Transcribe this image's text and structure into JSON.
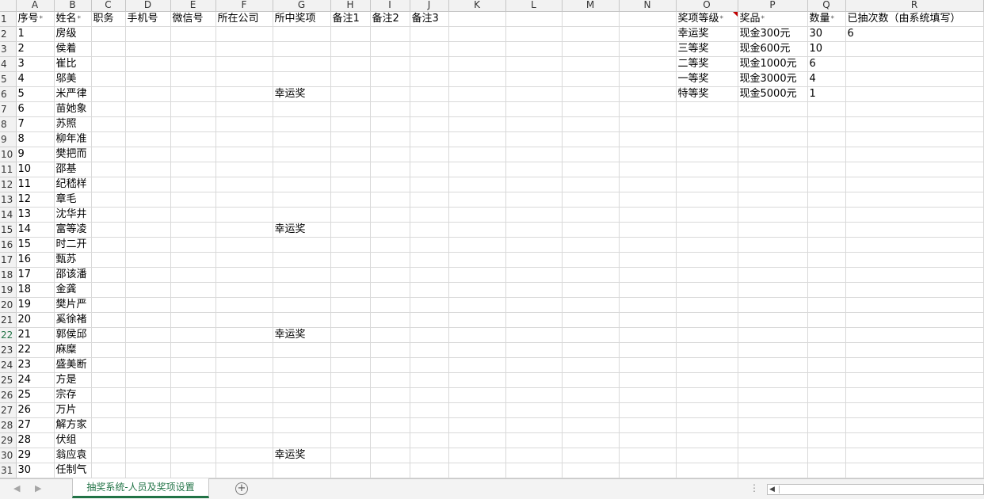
{
  "columns": [
    "A",
    "B",
    "C",
    "D",
    "E",
    "F",
    "G",
    "H",
    "I",
    "J",
    "K",
    "L",
    "M",
    "N",
    "O",
    "P",
    "Q",
    "R"
  ],
  "header_row": {
    "A": "序号",
    "B": "姓名",
    "C": "职务",
    "D": "手机号",
    "E": "微信号",
    "F": "所在公司",
    "G": "所中奖项",
    "H": "备注1",
    "I": "备注2",
    "J": "备注3",
    "O": "奖项等级",
    "P": "奖品",
    "Q": "数量",
    "R": "已抽次数（由系统填写）"
  },
  "required_marker": "*",
  "people": [
    {
      "id": "1",
      "name": "房级",
      "prize": ""
    },
    {
      "id": "2",
      "name": "侯着",
      "prize": ""
    },
    {
      "id": "3",
      "name": "崔比",
      "prize": ""
    },
    {
      "id": "4",
      "name": "邬美",
      "prize": ""
    },
    {
      "id": "5",
      "name": "米严律",
      "prize": "幸运奖"
    },
    {
      "id": "6",
      "name": "苗她象",
      "prize": ""
    },
    {
      "id": "7",
      "name": "苏照",
      "prize": ""
    },
    {
      "id": "8",
      "name": "柳年准",
      "prize": ""
    },
    {
      "id": "9",
      "name": "樊把而",
      "prize": ""
    },
    {
      "id": "10",
      "name": "邵基",
      "prize": ""
    },
    {
      "id": "11",
      "name": "纪嵇样",
      "prize": ""
    },
    {
      "id": "12",
      "name": "章毛",
      "prize": ""
    },
    {
      "id": "13",
      "name": "沈华井",
      "prize": ""
    },
    {
      "id": "14",
      "name": "富等凌",
      "prize": "幸运奖"
    },
    {
      "id": "15",
      "name": "时二开",
      "prize": ""
    },
    {
      "id": "16",
      "name": "甄苏",
      "prize": ""
    },
    {
      "id": "17",
      "name": "邵该潘",
      "prize": ""
    },
    {
      "id": "18",
      "name": "金龚",
      "prize": ""
    },
    {
      "id": "19",
      "name": "樊片严",
      "prize": ""
    },
    {
      "id": "20",
      "name": "奚徐褚",
      "prize": ""
    },
    {
      "id": "21",
      "name": "郭侯邱",
      "prize": "幸运奖"
    },
    {
      "id": "22",
      "name": "麻糜",
      "prize": ""
    },
    {
      "id": "23",
      "name": "盛美断",
      "prize": ""
    },
    {
      "id": "24",
      "name": "方是",
      "prize": ""
    },
    {
      "id": "25",
      "name": "宗存",
      "prize": ""
    },
    {
      "id": "26",
      "name": "万片",
      "prize": ""
    },
    {
      "id": "27",
      "name": "解方家",
      "prize": ""
    },
    {
      "id": "28",
      "name": "伏组",
      "prize": ""
    },
    {
      "id": "29",
      "name": "翁应袁",
      "prize": "幸运奖"
    },
    {
      "id": "30",
      "name": "任制气",
      "prize": ""
    }
  ],
  "awards": [
    {
      "level": "幸运奖",
      "item": "现金300元",
      "qty": "30",
      "drawn": "6"
    },
    {
      "level": "三等奖",
      "item": "现金600元",
      "qty": "10",
      "drawn": ""
    },
    {
      "level": "二等奖",
      "item": "现金1000元",
      "qty": "6",
      "drawn": ""
    },
    {
      "level": "一等奖",
      "item": "现金3000元",
      "qty": "4",
      "drawn": ""
    },
    {
      "level": "特等奖",
      "item": "现金5000元",
      "qty": "1",
      "drawn": ""
    }
  ],
  "sheet_tab": "抽奖系统-人员及奖项设置",
  "icons": {
    "nav_prev": "chevron-left-icon",
    "nav_next": "chevron-right-icon",
    "add_sheet": "plus-circle-icon",
    "scroll_left": "scroll-left-icon"
  },
  "colors": {
    "accent": "#217346",
    "comment_indicator": "#c00000"
  }
}
